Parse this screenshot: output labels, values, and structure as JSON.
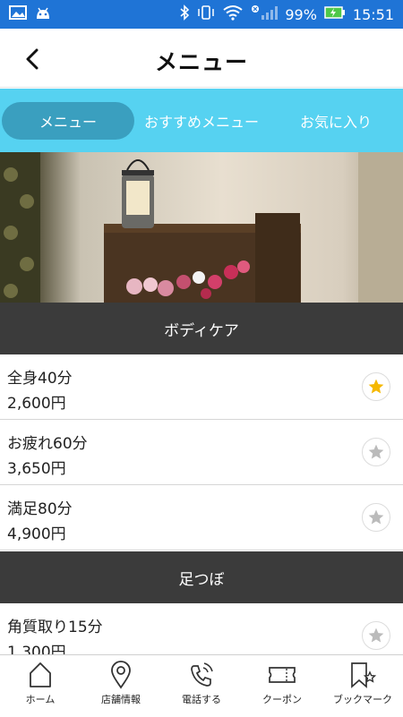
{
  "status": {
    "battery": "99%",
    "time": "15:51"
  },
  "header": {
    "title": "メニュー"
  },
  "tabs": [
    {
      "label": "メニュー"
    },
    {
      "label": "おすすめメニュー"
    },
    {
      "label": "お気に入り"
    }
  ],
  "sections": [
    {
      "title": "ボディケア",
      "items": [
        {
          "name": "全身40分",
          "price": "2,600円",
          "favorited": true
        },
        {
          "name": "お疲れ60分",
          "price": "3,650円",
          "favorited": false
        },
        {
          "name": "満足80分",
          "price": "4,900円",
          "favorited": false
        }
      ]
    },
    {
      "title": "足つぼ",
      "items": [
        {
          "name": "角質取り15分",
          "price": "1,300円",
          "favorited": false
        }
      ]
    }
  ],
  "bottom_nav": [
    {
      "label": "ホーム",
      "icon": "home-icon"
    },
    {
      "label": "店舗情報",
      "icon": "map-pin-icon"
    },
    {
      "label": "電話する",
      "icon": "phone-icon"
    },
    {
      "label": "クーポン",
      "icon": "coupon-icon"
    },
    {
      "label": "ブックマーク",
      "icon": "bookmark-icon"
    }
  ],
  "colors": {
    "statusbar": "#1f74d6",
    "tabs_bg": "#56d2f1",
    "tab_active": "#3a9fbf",
    "section_bg": "#3b3b3b",
    "star_active": "#f5b800",
    "star_inactive": "#bbbbbb"
  }
}
